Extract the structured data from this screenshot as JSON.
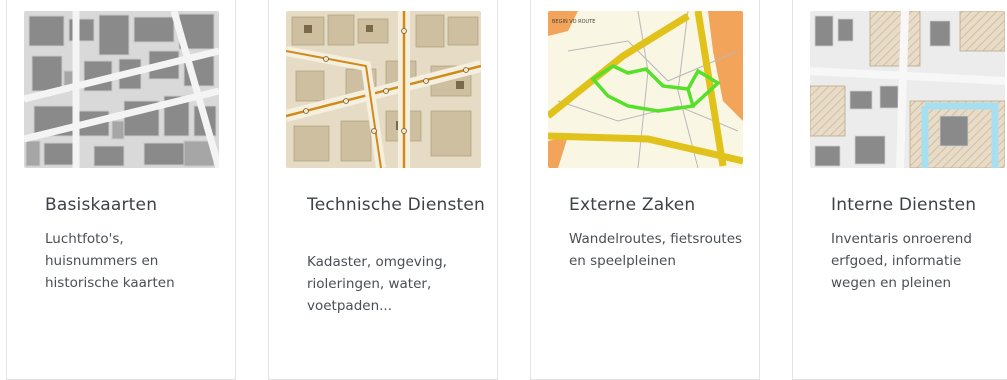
{
  "cards": [
    {
      "title": "Basiskaarten",
      "desc": "Luchtfoto's, huisnummers en historische kaarten",
      "image": "cadastral-map-gray-thumbnail"
    },
    {
      "title": "Technische Diensten",
      "desc": "Kadaster, omgeving, rioleringen, water, voetpaden...",
      "image": "sewer-network-map-thumbnail"
    },
    {
      "title": "Externe Zaken",
      "desc": "Wandelroutes, fietsroutes en speelpleinen",
      "image": "walking-routes-map-thumbnail",
      "map_label": "BEGIN VD ROUTE"
    },
    {
      "title": "Interne Diensten",
      "desc": "Inventaris onroerend erfgoed, informatie wegen en pleinen",
      "image": "heritage-inventory-map-thumbnail"
    }
  ],
  "colors": {
    "title_text": "#3d4248",
    "desc_text": "#4a4f55",
    "card_border": "#e3e3e3"
  }
}
